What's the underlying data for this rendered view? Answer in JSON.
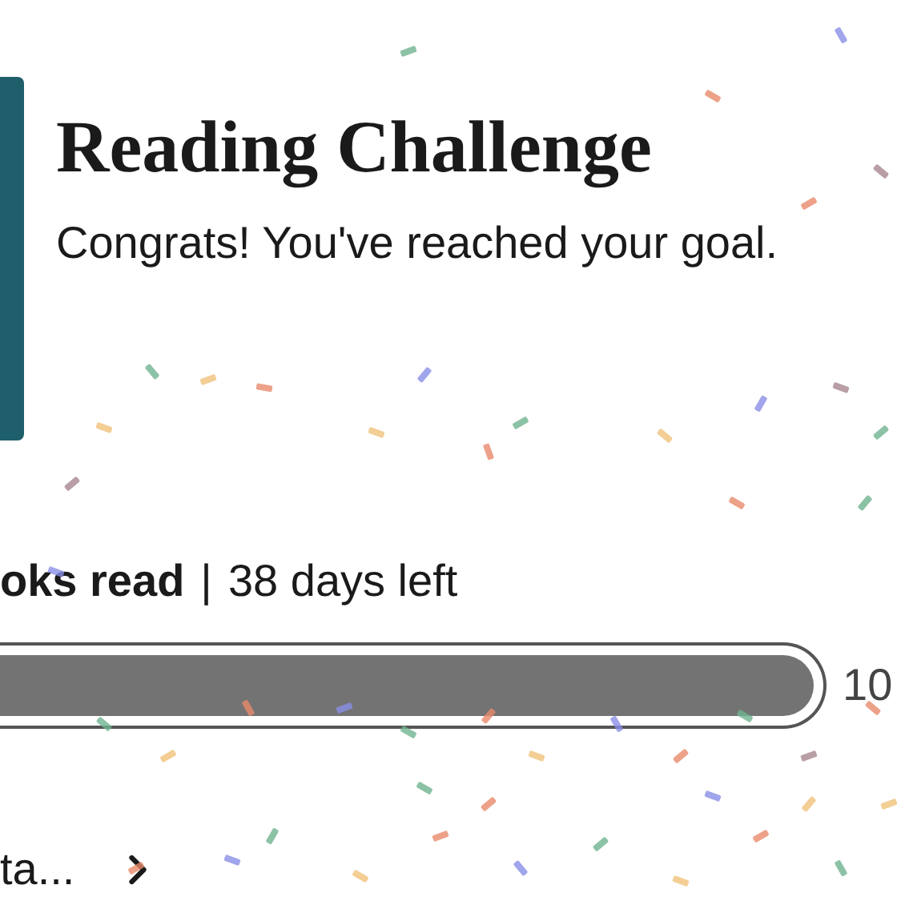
{
  "challenge": {
    "title": "Reading Challenge",
    "message": "Congrats! You've reached your goal."
  },
  "progress": {
    "books_read": "oks read",
    "separator": "|",
    "days_left": "38 days left",
    "level": 1,
    "count": "10"
  },
  "link": {
    "label": "ta..."
  }
}
